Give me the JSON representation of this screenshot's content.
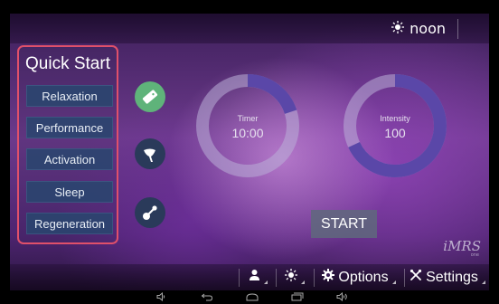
{
  "topbar": {
    "time_of_day": "noon"
  },
  "quick_start": {
    "title": "Quick Start",
    "buttons": [
      "Relaxation",
      "Performance",
      "Activation",
      "Sleep",
      "Regeneration"
    ]
  },
  "timer": {
    "label": "Timer",
    "value": "10:00",
    "progress": 0.2
  },
  "intensity": {
    "label": "Intensity",
    "value": "100",
    "progress": 0.68
  },
  "start_label": "START",
  "logo": {
    "text": "iMRS",
    "sub": "one"
  },
  "bottombar": {
    "options_label": "Options",
    "settings_label": "Settings"
  },
  "colors": {
    "accent_red": "#e0506a",
    "mode_active": "#5fb37a",
    "ring_fill": "#5a47a8"
  },
  "icons": {
    "time_of_day": "sun-icon",
    "modes": [
      "bandage-pad-icon",
      "spot-applicator-icon",
      "pen-applicator-icon"
    ],
    "bottom": [
      "user-icon",
      "brightness-icon",
      "gear-icon",
      "tools-icon"
    ],
    "nav": [
      "volume-down-icon",
      "back-icon",
      "home-icon",
      "recent-apps-icon",
      "volume-up-icon"
    ]
  }
}
